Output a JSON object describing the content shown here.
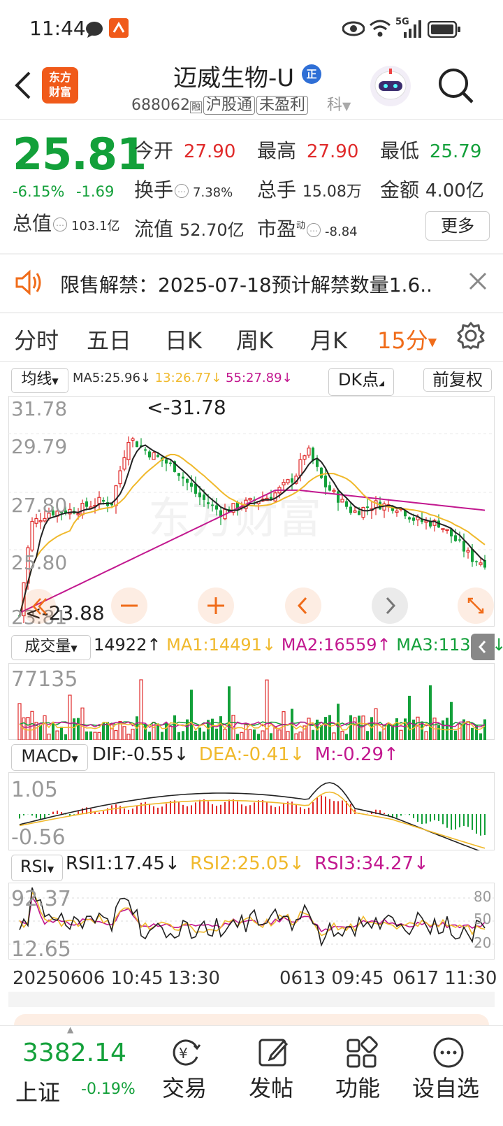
{
  "status_bar": {
    "time": "11:44",
    "network": "5G"
  },
  "header": {
    "logo_text_1": "东方",
    "logo_text_2": "财富",
    "title": "迈威生物-U",
    "badge": "正",
    "code": "688062",
    "tag_small": "融",
    "tags": [
      "沪股通",
      "未盈利"
    ],
    "tag_cut": "科"
  },
  "quote": {
    "price": "25.81",
    "change_pct": "-6.15%",
    "change": "-1.69",
    "open_label": "今开",
    "open": "27.90",
    "high_label": "最高",
    "high": "27.90",
    "low_label": "最低",
    "low": "25.79",
    "turnover_label": "换手",
    "turnover": "7.38%",
    "volume_label": "总手",
    "volume": "15.08万",
    "amount_label": "金额",
    "amount": "4.00亿",
    "mktcap_label": "总值",
    "mktcap": "103.1亿",
    "float_label": "流值",
    "float": "52.70亿",
    "pe_label": "市盈",
    "pe_sup": "动",
    "pe": "-8.84",
    "more_label": "更多"
  },
  "notice": {
    "text": "限售解禁：2025-07-18预计解禁数量1.6.."
  },
  "tabs": [
    "分时",
    "五日",
    "日K",
    "周K",
    "月K",
    "15分"
  ],
  "chart": {
    "mean_select": "均线",
    "ma5": "MA5:25.96↓",
    "ma13": "13:26.77↓",
    "ma55": "55:27.89↓",
    "dk_label": "DK点",
    "adjust_label": "前复权",
    "y_ticks": [
      "31.78",
      "29.79",
      "27.80",
      "25.80",
      "23.81"
    ],
    "max_label": "<-31.78",
    "min_label": "<-23.88",
    "watermark": "东方财富",
    "vol_select": "成交量",
    "vol_cur": "14922↑",
    "vol_ma1": "MA1:14491↓",
    "vol_ma2": "MA2:16559↑",
    "vol_ma3": "MA3:11388↓",
    "vol_max": "77135",
    "macd_select": "MACD",
    "macd_dif": "DIF:-0.55↓",
    "macd_dea": "DEA:-0.41↓",
    "macd_m": "M:-0.29↑",
    "macd_top": "1.05",
    "macd_bot": "-0.56",
    "rsi_select": "RSI",
    "rsi1": "RSI1:17.45↓",
    "rsi2": "RSI2:25.05↓",
    "rsi3": "RSI3:34.27↓",
    "rsi_top": "92.37",
    "rsi_bot": "12.65",
    "rsi_levels": [
      "80",
      "50",
      "20"
    ],
    "date_1": "20250606 10:45",
    "date_2": "13:30",
    "date_3": "0613 09:45",
    "date_4": "0617 11:30"
  },
  "bottom": {
    "index_value": "3382.14",
    "index_name": "上证",
    "index_change": "-0.19%",
    "nav": [
      "交易",
      "发帖",
      "功能",
      "设自选"
    ]
  },
  "colors": {
    "up": "#e02b2b",
    "down": "#13a03a",
    "accent": "#f06c1a",
    "ma13": "#f0b92c",
    "ma55": "#c2188f"
  }
}
